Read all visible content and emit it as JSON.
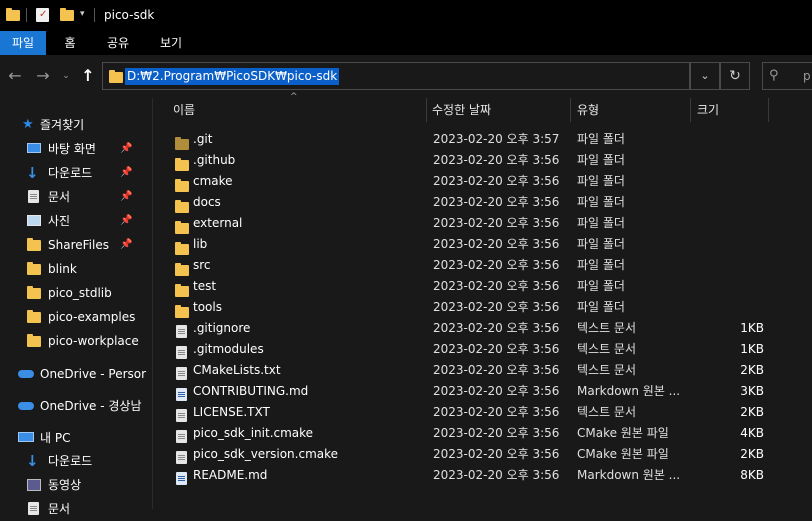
{
  "window": {
    "title": "pico-sdk"
  },
  "ribbon": {
    "tabs": [
      "파일",
      "홈",
      "공유",
      "보기"
    ],
    "active_color": "#1976d2"
  },
  "address": {
    "path": "D:₩2.Program₩PicoSDK₩pico-sdk",
    "search_placeholder": "p"
  },
  "sidebar": {
    "quick_access_label": "즐겨찾기",
    "items": [
      {
        "label": "바탕 화면",
        "icon": "desktop-icon",
        "pinned": true
      },
      {
        "label": "다운로드",
        "icon": "download-icon",
        "pinned": true
      },
      {
        "label": "문서",
        "icon": "document-icon",
        "pinned": true
      },
      {
        "label": "사진",
        "icon": "pictures-icon",
        "pinned": true
      },
      {
        "label": "ShareFiles",
        "icon": "folder-icon",
        "pinned": true
      },
      {
        "label": "blink",
        "icon": "folder-icon",
        "pinned": false
      },
      {
        "label": "pico_stdlib",
        "icon": "folder-icon",
        "pinned": false
      },
      {
        "label": "pico-examples",
        "icon": "folder-icon",
        "pinned": false
      },
      {
        "label": "pico-workplace",
        "icon": "folder-icon",
        "pinned": false
      }
    ],
    "onedrive_personal": "OneDrive - Persor",
    "onedrive_org": "OneDrive - 경상남",
    "this_pc": "내 PC",
    "pc_items": [
      {
        "label": "다운로드",
        "icon": "download-icon"
      },
      {
        "label": "동영상",
        "icon": "video-icon"
      },
      {
        "label": "문서",
        "icon": "document-icon"
      }
    ]
  },
  "columns": {
    "name": "이름",
    "modified": "수정한 날짜",
    "type": "유형",
    "size": "크기"
  },
  "files": [
    {
      "name": ".git",
      "modified": "2023-02-20 오후 3:57",
      "type": "파일 폴더",
      "size": "",
      "kind": "folder-dark"
    },
    {
      "name": ".github",
      "modified": "2023-02-20 오후 3:56",
      "type": "파일 폴더",
      "size": "",
      "kind": "folder"
    },
    {
      "name": "cmake",
      "modified": "2023-02-20 오후 3:56",
      "type": "파일 폴더",
      "size": "",
      "kind": "folder"
    },
    {
      "name": "docs",
      "modified": "2023-02-20 오후 3:56",
      "type": "파일 폴더",
      "size": "",
      "kind": "folder"
    },
    {
      "name": "external",
      "modified": "2023-02-20 오후 3:56",
      "type": "파일 폴더",
      "size": "",
      "kind": "folder"
    },
    {
      "name": "lib",
      "modified": "2023-02-20 오후 3:56",
      "type": "파일 폴더",
      "size": "",
      "kind": "folder"
    },
    {
      "name": "src",
      "modified": "2023-02-20 오후 3:56",
      "type": "파일 폴더",
      "size": "",
      "kind": "folder"
    },
    {
      "name": "test",
      "modified": "2023-02-20 오후 3:56",
      "type": "파일 폴더",
      "size": "",
      "kind": "folder"
    },
    {
      "name": "tools",
      "modified": "2023-02-20 오후 3:56",
      "type": "파일 폴더",
      "size": "",
      "kind": "folder"
    },
    {
      "name": ".gitignore",
      "modified": "2023-02-20 오후 3:56",
      "type": "텍스트 문서",
      "size": "1KB",
      "kind": "file"
    },
    {
      "name": ".gitmodules",
      "modified": "2023-02-20 오후 3:56",
      "type": "텍스트 문서",
      "size": "1KB",
      "kind": "file"
    },
    {
      "name": "CMakeLists.txt",
      "modified": "2023-02-20 오후 3:56",
      "type": "텍스트 문서",
      "size": "2KB",
      "kind": "file"
    },
    {
      "name": "CONTRIBUTING.md",
      "modified": "2023-02-20 오후 3:56",
      "type": "Markdown 원본 ...",
      "size": "3KB",
      "kind": "md"
    },
    {
      "name": "LICENSE.TXT",
      "modified": "2023-02-20 오후 3:56",
      "type": "텍스트 문서",
      "size": "2KB",
      "kind": "file"
    },
    {
      "name": "pico_sdk_init.cmake",
      "modified": "2023-02-20 오후 3:56",
      "type": "CMake 원본 파일",
      "size": "4KB",
      "kind": "file"
    },
    {
      "name": "pico_sdk_version.cmake",
      "modified": "2023-02-20 오후 3:56",
      "type": "CMake 원본 파일",
      "size": "2KB",
      "kind": "file"
    },
    {
      "name": "README.md",
      "modified": "2023-02-20 오후 3:56",
      "type": "Markdown 원본 ...",
      "size": "8KB",
      "kind": "md"
    }
  ]
}
